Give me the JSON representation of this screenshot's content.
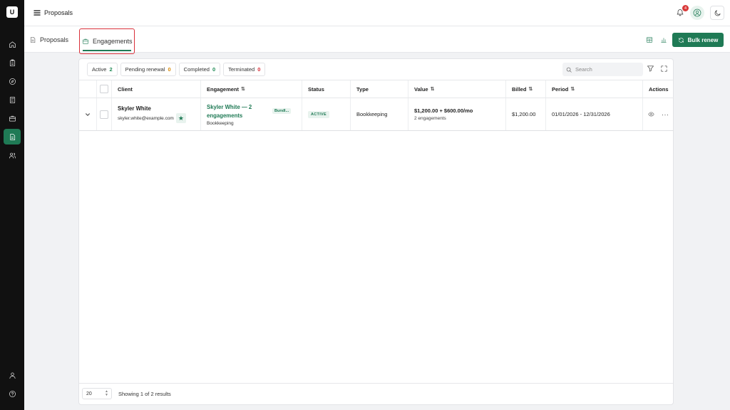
{
  "app": {
    "logo_letter": "U",
    "page_title": "Proposals",
    "notification_count": "4"
  },
  "sidebar": {
    "items": [
      {
        "icon": "home-icon"
      },
      {
        "icon": "clipboard-icon"
      },
      {
        "icon": "compass-icon"
      },
      {
        "icon": "calculator-icon"
      },
      {
        "icon": "briefcase-icon"
      },
      {
        "icon": "document-icon",
        "active": true
      },
      {
        "icon": "users-icon"
      }
    ],
    "bottom_items": [
      {
        "icon": "user-icon"
      },
      {
        "icon": "help-icon"
      }
    ]
  },
  "tabs": [
    {
      "label": "Proposals",
      "icon": "document-icon"
    },
    {
      "label": "Engagements",
      "icon": "briefcase-icon",
      "active": true
    }
  ],
  "toolbar": {
    "bulk_renew_label": "Bulk renew"
  },
  "filters": [
    {
      "label": "Active",
      "count": "2",
      "color": "#1f8a55"
    },
    {
      "label": "Pending renewal",
      "count": "0",
      "color": "#d98a0a"
    },
    {
      "label": "Completed",
      "count": "0",
      "color": "#1f8a55"
    },
    {
      "label": "Terminated",
      "count": "0",
      "color": "#d9303a"
    }
  ],
  "search": {
    "placeholder": "Search",
    "value": ""
  },
  "table": {
    "headers": {
      "client": "Client",
      "engagement": "Engagement",
      "status": "Status",
      "type": "Type",
      "value": "Value",
      "billed": "Billed",
      "period": "Period",
      "actions": "Actions"
    },
    "rows": [
      {
        "client_name": "Skyler White",
        "client_email": "skyler.white@example.com",
        "engagement_title": "Skyler White — 2 engagements",
        "engagement_badge": "Bundl...",
        "engagement_sub": "Bookkeeping",
        "status": "ACTIVE",
        "type": "Bookkeeping",
        "value": "$1,200.00 + $600.00/mo",
        "value_sub": "2 engagements",
        "billed": "$1,200.00",
        "period": "01/01/2026 - 12/31/2026"
      }
    ]
  },
  "footer": {
    "page_size": "20",
    "showing_text": "Showing 1 of 2 results"
  },
  "colors": {
    "accent": "#1f7a55",
    "sidebar_bg": "#111111",
    "highlight_border": "#d9303a"
  }
}
